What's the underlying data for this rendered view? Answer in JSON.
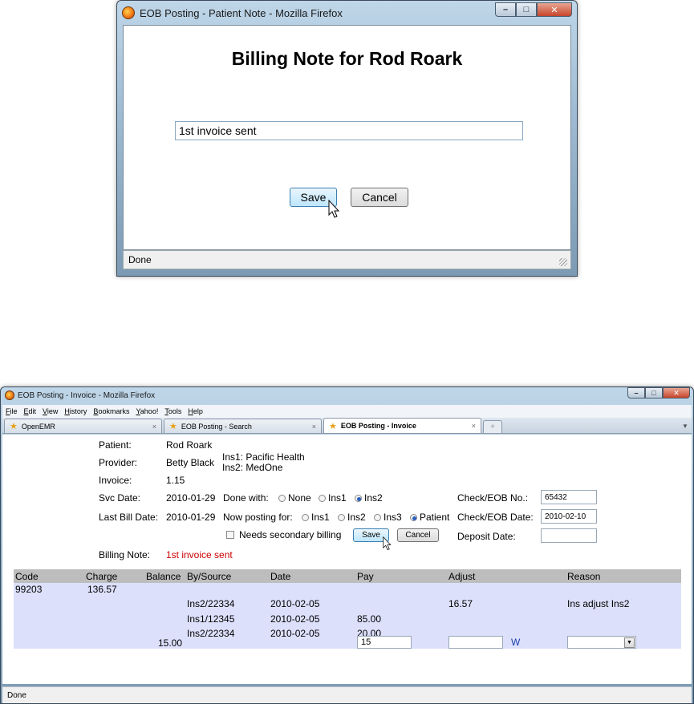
{
  "popup": {
    "window_title": "EOB Posting - Patient Note - Mozilla Firefox",
    "heading": "Billing Note for Rod Roark",
    "note_value": "1st invoice sent",
    "save_label": "Save",
    "cancel_label": "Cancel",
    "status": "Done"
  },
  "main": {
    "window_title": "EOB Posting - Invoice - Mozilla Firefox",
    "menu": [
      "File",
      "Edit",
      "View",
      "History",
      "Bookmarks",
      "Yahoo!",
      "Tools",
      "Help"
    ],
    "tabs": [
      {
        "label": "OpenEMR"
      },
      {
        "label": "EOB Posting - Search"
      },
      {
        "label": "EOB Posting - Invoice"
      }
    ],
    "new_tab_symbol": "+",
    "labels": {
      "patient": "Patient:",
      "provider": "Provider:",
      "invoice": "Invoice:",
      "svc_date": "Svc Date:",
      "last_bill_date": "Last Bill Date:",
      "billing_note": "Billing Note:",
      "done_with": "Done with:",
      "now_posting_for": "Now posting for:",
      "check_eob_no": "Check/EOB No.:",
      "check_eob_date": "Check/EOB Date:",
      "deposit_date": "Deposit Date:",
      "needs_secondary": "Needs secondary billing"
    },
    "values": {
      "patient": "Rod Roark",
      "provider": "Betty Black",
      "ins1": "Ins1: Pacific Health",
      "ins2": "Ins2: MedOne",
      "invoice": "1.15",
      "svc_date": "2010-01-29",
      "last_bill_date": "2010-01-29",
      "billing_note": "1st invoice sent",
      "check_eob_no": "65432",
      "check_eob_date": "2010-02-10",
      "deposit_date": ""
    },
    "done_with_options": [
      "None",
      "Ins1",
      "Ins2"
    ],
    "done_with_selected": "Ins2",
    "posting_for_options": [
      "Ins1",
      "Ins2",
      "Ins3",
      "Patient"
    ],
    "posting_for_selected": "Patient",
    "save_label": "Save",
    "cancel_label": "Cancel",
    "table": {
      "headers": [
        "Code",
        "Charge",
        "Balance",
        "By/Source",
        "Date",
        "Pay",
        "Adjust",
        "Reason"
      ],
      "code_row": {
        "code": "99203",
        "charge": "136.57"
      },
      "rows": [
        {
          "source": "Ins2/22334",
          "date": "2010-02-05",
          "pay": "",
          "adjust": "16.57",
          "reason": "Ins adjust Ins2"
        },
        {
          "source": "Ins1/12345",
          "date": "2010-02-05",
          "pay": "85.00",
          "adjust": "",
          "reason": ""
        },
        {
          "source": "Ins2/22334",
          "date": "2010-02-05",
          "pay": "20.00",
          "adjust": "",
          "reason": ""
        }
      ],
      "entry": {
        "balance": "15.00",
        "pay": "15",
        "adjust": "",
        "w_label": "W",
        "reason": ""
      }
    },
    "status": "Done"
  },
  "colors": {
    "billing_note": "#cc0000",
    "table_header": "#bdbdbd",
    "table_body": "#dde0fb",
    "w_link": "#1a3fa8"
  }
}
